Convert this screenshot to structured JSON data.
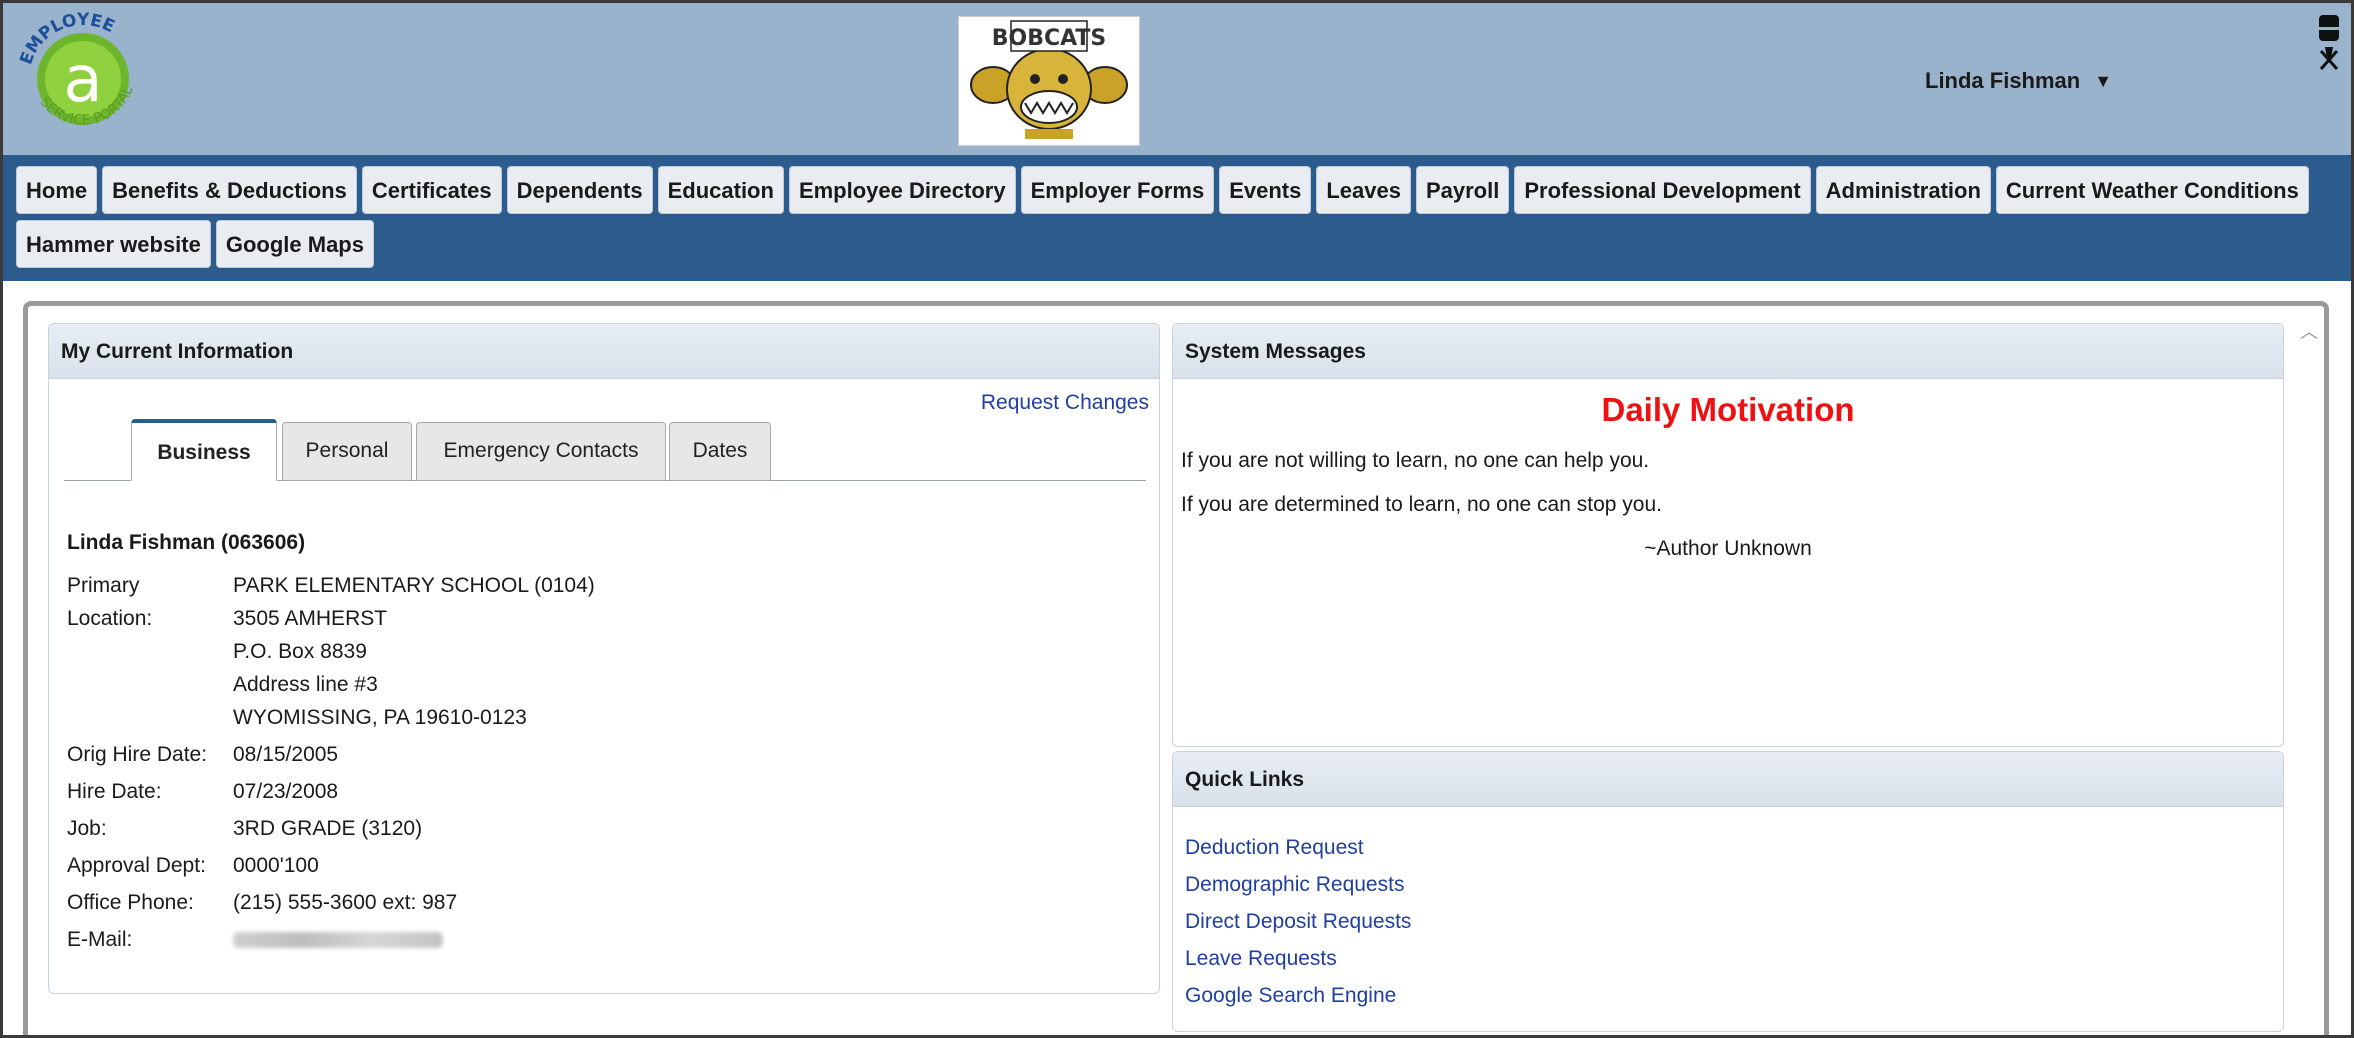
{
  "header": {
    "logo_letter": "a",
    "logo_text": "EMPLOYEE SERVICE PORTAL",
    "school_logo_text": "BOBCATS",
    "user_name": "Linda Fishman",
    "user_caret": "▼"
  },
  "nav": {
    "row1": [
      "Home",
      "Benefits & Deductions",
      "Certificates",
      "Dependents",
      "Education",
      "Employee Directory",
      "Employer Forms",
      "Events",
      "Leaves",
      "Payroll",
      "Professional Development",
      "Administration",
      "Current Weather Conditions"
    ],
    "row2": [
      "Hammer website",
      "Google Maps"
    ]
  },
  "info": {
    "title": "My Current Information",
    "request_changes": "Request Changes",
    "tabs": [
      "Business",
      "Personal",
      "Emergency Contacts",
      "Dates"
    ],
    "employee": "Linda Fishman (063606)",
    "primary_label": "Primary",
    "location_label": "Location:",
    "location_lines": [
      "PARK ELEMENTARY SCHOOL (0104)",
      "3505 AMHERST",
      "P.O. Box 8839",
      "Address line #3",
      "WYOMISSING, PA 19610-0123"
    ],
    "orig_hire_label": "Orig Hire Date:",
    "orig_hire": "08/15/2005",
    "hire_label": "Hire Date:",
    "hire": "07/23/2008",
    "job_label": "Job:",
    "job": "3RD GRADE (3120)",
    "dept_label": "Approval Dept:",
    "dept": "0000'100",
    "phone_label": "Office Phone:",
    "phone": "(215) 555-3600 ext: 987",
    "email_label": "E-Mail:"
  },
  "messages": {
    "title": "System Messages",
    "heading": "Daily Motivation",
    "line1": "If you are not willing to learn, no one can help you.",
    "line2": "If you are determined to learn, no one can stop you.",
    "author": "~Author Unknown",
    "heading_color": "#ee1111"
  },
  "quick_links": {
    "title": "Quick Links",
    "items": [
      "Deduction Request",
      "Demographic Requests",
      "Direct Deposit Requests",
      "Leave Requests",
      "Google Search Engine"
    ]
  },
  "colors": {
    "header_bg": "#99b3cd",
    "nav_bg": "#2c5b8d",
    "link": "#1f3fa0"
  }
}
